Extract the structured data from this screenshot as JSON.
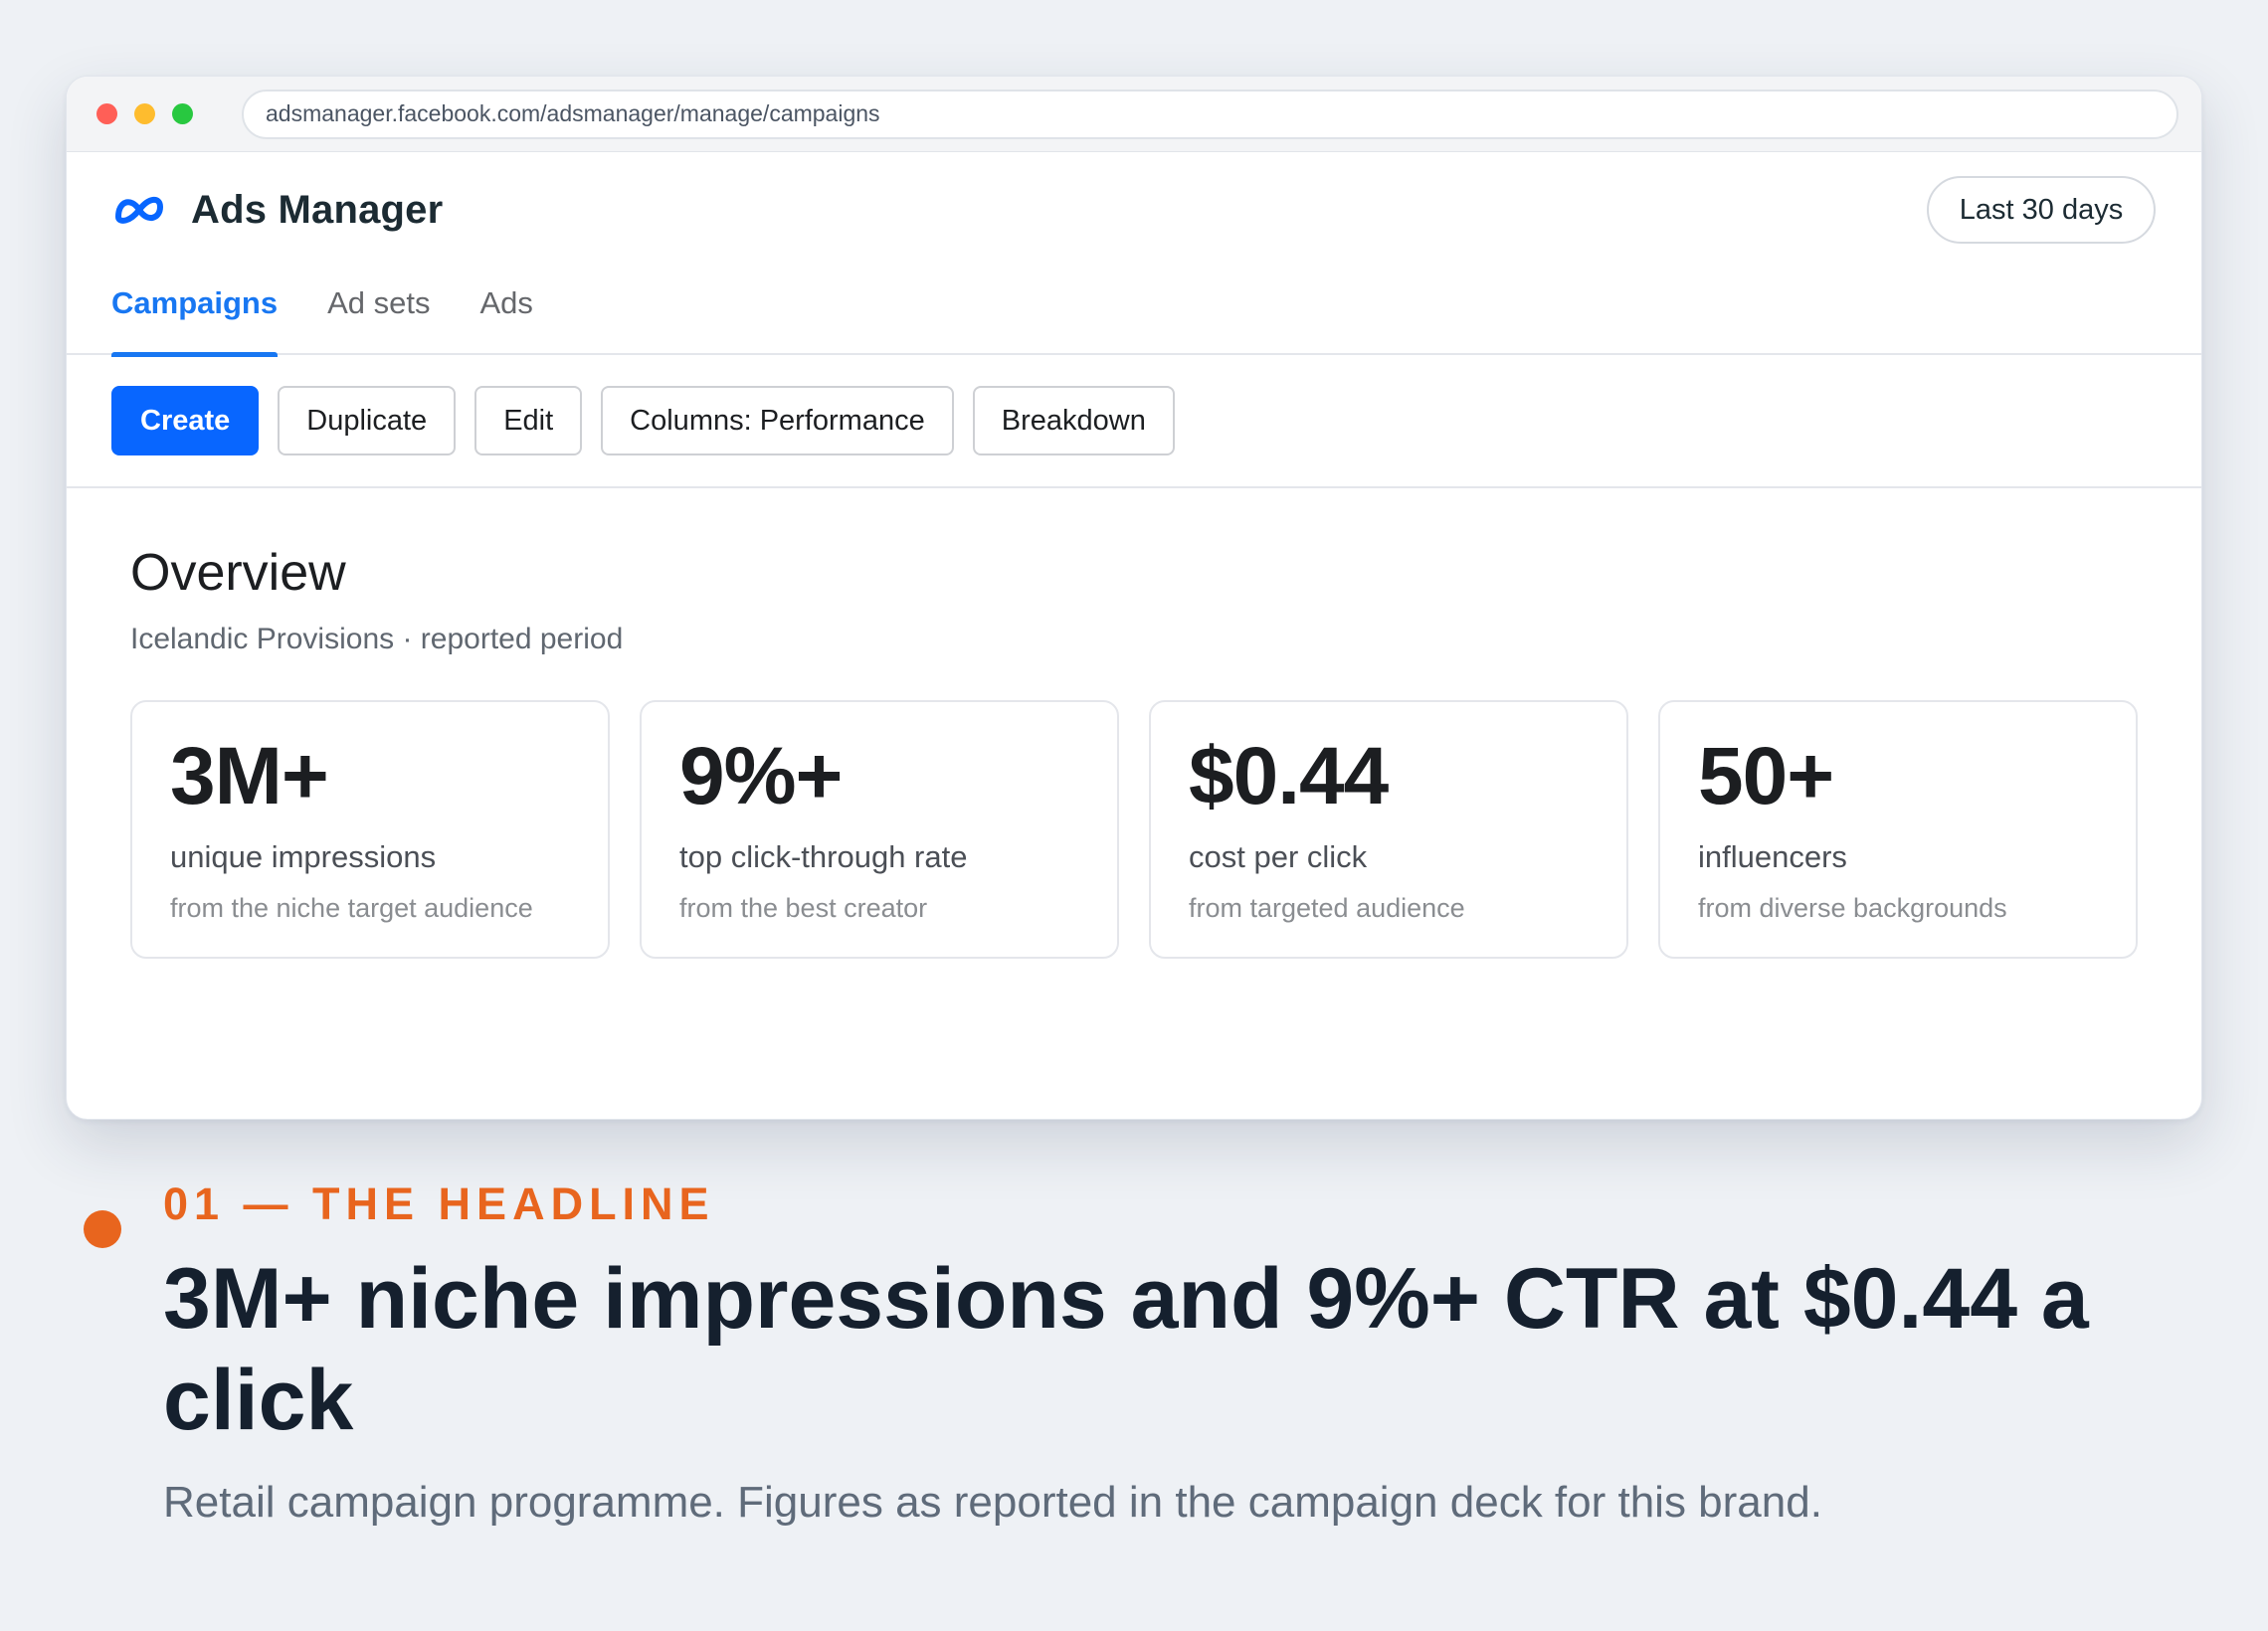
{
  "browser": {
    "url": "adsmanager.facebook.com/adsmanager/manage/campaigns"
  },
  "app": {
    "logo_icon": "meta-infinity-icon",
    "title": "Ads Manager",
    "date_range": "Last 30 days"
  },
  "tabs": [
    {
      "label": "Campaigns",
      "active": true
    },
    {
      "label": "Ad sets",
      "active": false
    },
    {
      "label": "Ads",
      "active": false
    }
  ],
  "toolbar": {
    "create": "Create",
    "duplicate": "Duplicate",
    "edit": "Edit",
    "columns": "Columns: Performance",
    "breakdown": "Breakdown"
  },
  "overview": {
    "title": "Overview",
    "subtitle": "Icelandic Provisions · reported period",
    "cards": [
      {
        "value": "3M+",
        "label": "unique impressions",
        "note": "from the niche target audience"
      },
      {
        "value": "9%+",
        "label": "top click-through rate",
        "note": "from the best creator"
      },
      {
        "value": "$0.44",
        "label": "cost per click",
        "note": "from targeted audience"
      },
      {
        "value": "50+",
        "label": "influencers",
        "note": "from diverse backgrounds"
      }
    ]
  },
  "caption": {
    "eyebrow": "01 — THE HEADLINE",
    "headline": "3M+ niche impressions and 9%+ CTR at $0.44 a click",
    "subline": "Retail campaign programme. Figures as reported in the campaign deck for this brand."
  },
  "colors": {
    "accent_blue": "#0866ff",
    "accent_orange": "#e8651e",
    "background": "#eef1f5"
  }
}
